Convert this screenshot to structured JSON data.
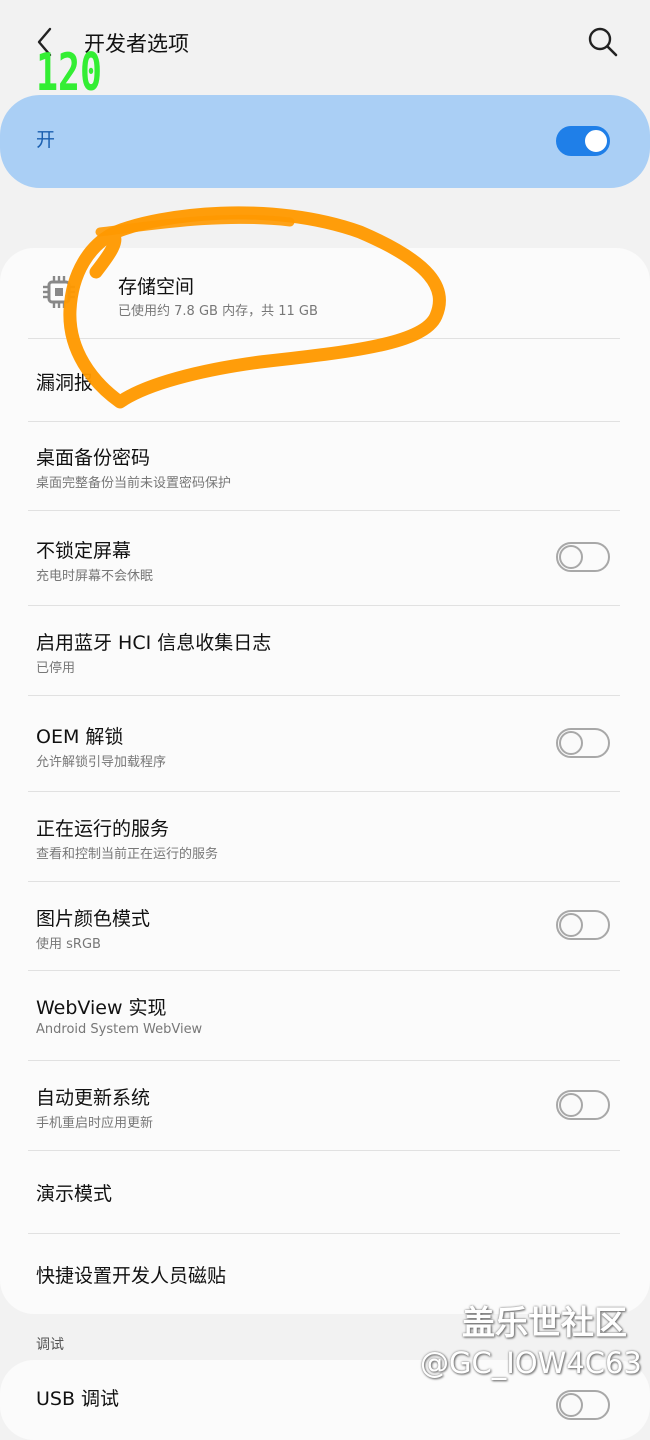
{
  "header": {
    "title": "开发者选项",
    "fps": "120"
  },
  "master_switch": {
    "label": "开",
    "on": true
  },
  "items": [
    {
      "title": "存储空间",
      "subtitle": "已使用约 7.8 GB 内存，共 11 GB",
      "icon": "chip-icon"
    },
    {
      "title": "漏洞报"
    },
    {
      "title": "桌面备份密码",
      "subtitle": "桌面完整备份当前未设置密码保护"
    },
    {
      "title": "不锁定屏幕",
      "subtitle": "充电时屏幕不会休眠",
      "toggle": false
    },
    {
      "title": "启用蓝牙 HCI 信息收集日志",
      "subtitle": "已停用"
    },
    {
      "title": "OEM 解锁",
      "subtitle": "允许解锁引导加载程序",
      "toggle": false
    },
    {
      "title": "正在运行的服务",
      "subtitle": "查看和控制当前正在运行的服务"
    },
    {
      "title": "图片颜色模式",
      "subtitle": "使用 sRGB",
      "toggle": false
    },
    {
      "title": "WebView 实现",
      "subtitle": "Android System WebView"
    },
    {
      "title": "自动更新系统",
      "subtitle": "手机重启时应用更新",
      "toggle": false
    },
    {
      "title": "演示模式"
    },
    {
      "title": "快捷设置开发人员磁贴"
    }
  ],
  "debug_section": {
    "header": "调试",
    "items": [
      {
        "title": "USB 调试",
        "toggle": false
      }
    ]
  },
  "watermark": {
    "line1": "盖乐世社区",
    "line2": "@GC_IOW4C63"
  },
  "colors": {
    "accent": "#1f7fe8",
    "master_bg": "#aacff5",
    "annotation": "#ff9900",
    "fps": "#33ee33"
  }
}
